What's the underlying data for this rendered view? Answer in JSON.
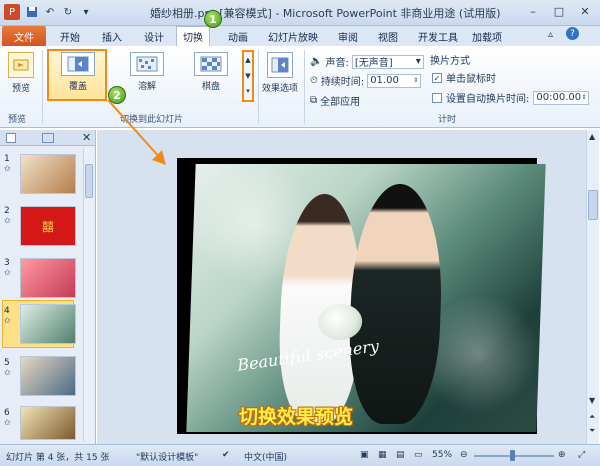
{
  "window": {
    "title": "婚纱相册.ppt [兼容模式] - Microsoft PowerPoint 非商业用途 (试用版)",
    "controls": {
      "minimize": "–",
      "maximize": "□",
      "close": "✕"
    }
  },
  "quick_access": [
    "save-icon",
    "undo-icon",
    "redo-icon",
    "customize-icon"
  ],
  "tabs": [
    "文件",
    "开始",
    "插入",
    "设计",
    "切换",
    "动画",
    "幻灯片放映",
    "审阅",
    "视图",
    "开发工具",
    "加载项"
  ],
  "ribbon": {
    "preview": {
      "label": "预览",
      "group": "预览"
    },
    "transitions": {
      "group": "切换到此幻灯片",
      "items": [
        "覆盖",
        "溶解",
        "棋盘"
      ],
      "selected": "覆盖"
    },
    "effect_options": {
      "label": "效果选项"
    },
    "timing": {
      "group": "计时",
      "sound_label": "声音:",
      "sound_value": "[无声音]",
      "duration_label": "持续时间:",
      "duration_value": "01.00",
      "apply_all": "全部应用",
      "advance_title": "换片方式",
      "on_click_label": "单击鼠标时",
      "on_click_checked": true,
      "after_label": "设置自动换片时间:",
      "after_value": "00:00.00",
      "after_checked": false
    }
  },
  "left_panel": {
    "slides": [
      {
        "num": "1",
        "selected": false
      },
      {
        "num": "2",
        "selected": false
      },
      {
        "num": "3",
        "selected": false
      },
      {
        "num": "4",
        "selected": true
      },
      {
        "num": "5",
        "selected": false
      },
      {
        "num": "6",
        "selected": false
      }
    ]
  },
  "slide": {
    "script_text": "Beautiful scenery",
    "caption": "切换效果预览"
  },
  "annotations": {
    "step1": "1",
    "step2": "2"
  },
  "statusbar": {
    "slide_info": "幻灯片 第 4 张，共 15 张",
    "theme": "\"默认设计模板\"",
    "language": "中文(中国)",
    "zoom": "55%"
  },
  "colors": {
    "file_tab": "#d1551e",
    "highlight": "#f28a1a",
    "accent_green": "#4b9c19"
  }
}
